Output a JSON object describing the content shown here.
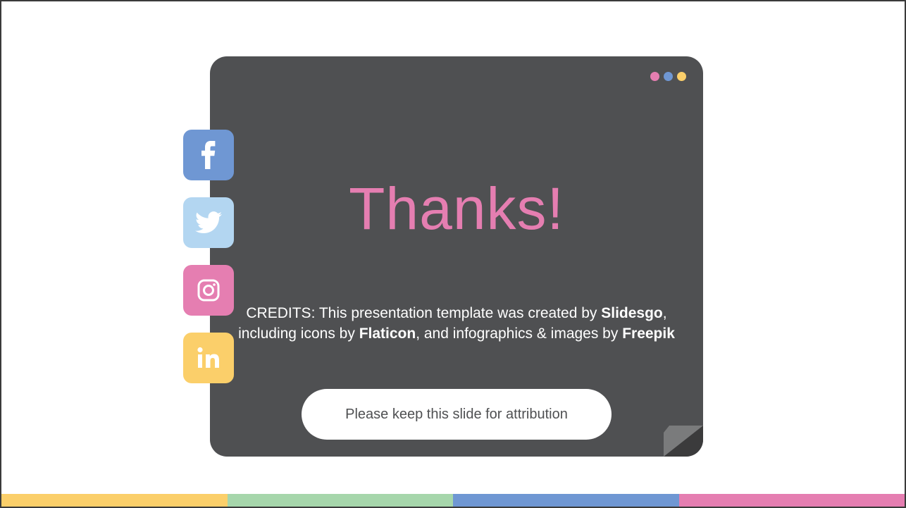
{
  "slide": {
    "title": "Thanks!",
    "credits": {
      "prefix": "CREDITS: This presentation template was created by",
      "brand1": "Slidesgo",
      "middle1": ", including icons by",
      "brand2": "Flaticon",
      "middle2": ", and infographics & images by",
      "brand3": "Freepik"
    },
    "attribution_button": "Please keep this slide for attribution"
  },
  "window_dots": [
    {
      "name": "pink-dot",
      "color": "#e57eb1"
    },
    {
      "name": "blue-dot",
      "color": "#6f97d3"
    },
    {
      "name": "yellow-dot",
      "color": "#fbcf6a"
    }
  ],
  "social_icons": [
    {
      "name": "facebook-icon",
      "color": "#6f97d3"
    },
    {
      "name": "twitter-icon",
      "color": "#b3d6f1"
    },
    {
      "name": "instagram-icon",
      "color": "#e57eb1"
    },
    {
      "name": "linkedin-icon",
      "color": "#fbcf6a"
    }
  ],
  "bottom_bar_colors": [
    "#fbcf6a",
    "#a6d6ab",
    "#6f97d3",
    "#e57eb1"
  ],
  "colors": {
    "card": "#4f5052",
    "title": "#e57eb1",
    "border": "#3a3a3a"
  }
}
